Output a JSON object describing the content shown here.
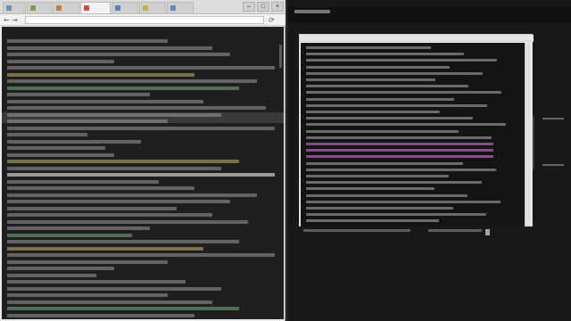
{
  "browser": {
    "tabs": [
      {
        "label": "",
        "favicon_color": "#6f8fb5"
      },
      {
        "label": "",
        "favicon_color": "#7aa05a"
      },
      {
        "label": "",
        "favicon_color": "#c08040"
      },
      {
        "label": "",
        "favicon_color": "#d04a4a",
        "active": true
      },
      {
        "label": "",
        "favicon_color": "#5a7fc0"
      },
      {
        "label": "",
        "favicon_color": "#c8b040"
      },
      {
        "label": "",
        "favicon_color": "#5a8ac0"
      }
    ],
    "address": "",
    "window_controls": {
      "minimize": "–",
      "maximize": "□",
      "close": "×"
    }
  },
  "nav": {
    "back": "←",
    "forward": "→",
    "reload": "⟳"
  },
  "terminal_left": {
    "title": ""
  },
  "popup": {
    "title": ""
  },
  "colors": {
    "terminal_bg": "#1f1f1f",
    "highlight_row": "#3a3a3a",
    "magenta_accent": "#b06ab0"
  }
}
